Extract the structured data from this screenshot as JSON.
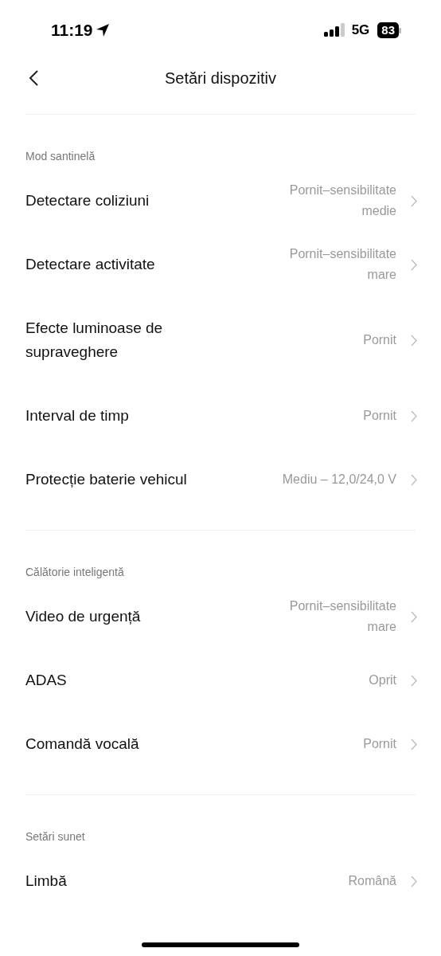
{
  "status_bar": {
    "time": "11:19",
    "network": "5G",
    "battery": "83"
  },
  "nav": {
    "title": "Setări dispozitiv"
  },
  "sections": [
    {
      "header": "Mod santinelă",
      "rows": [
        {
          "label": "Detectare coliziuni",
          "value": "Pornit–sensibilitate medie"
        },
        {
          "label": "Detectare activitate",
          "value": "Pornit–sensibilitate mare"
        },
        {
          "label": "Efecte luminoase de supraveghere",
          "value": "Pornit"
        },
        {
          "label": "Interval de timp",
          "value": "Pornit"
        },
        {
          "label": "Protecție baterie vehicul",
          "value": "Mediu – 12,0/24,0 V"
        }
      ]
    },
    {
      "header": "Călătorie inteligentă",
      "rows": [
        {
          "label": "Video de urgență",
          "value": "Pornit–sensibilitate mare"
        },
        {
          "label": "ADAS",
          "value": "Oprit"
        },
        {
          "label": "Comandă vocală",
          "value": "Pornit"
        }
      ]
    },
    {
      "header": "Setări sunet",
      "rows": [
        {
          "label": "Limbă",
          "value": "Română"
        }
      ]
    }
  ]
}
